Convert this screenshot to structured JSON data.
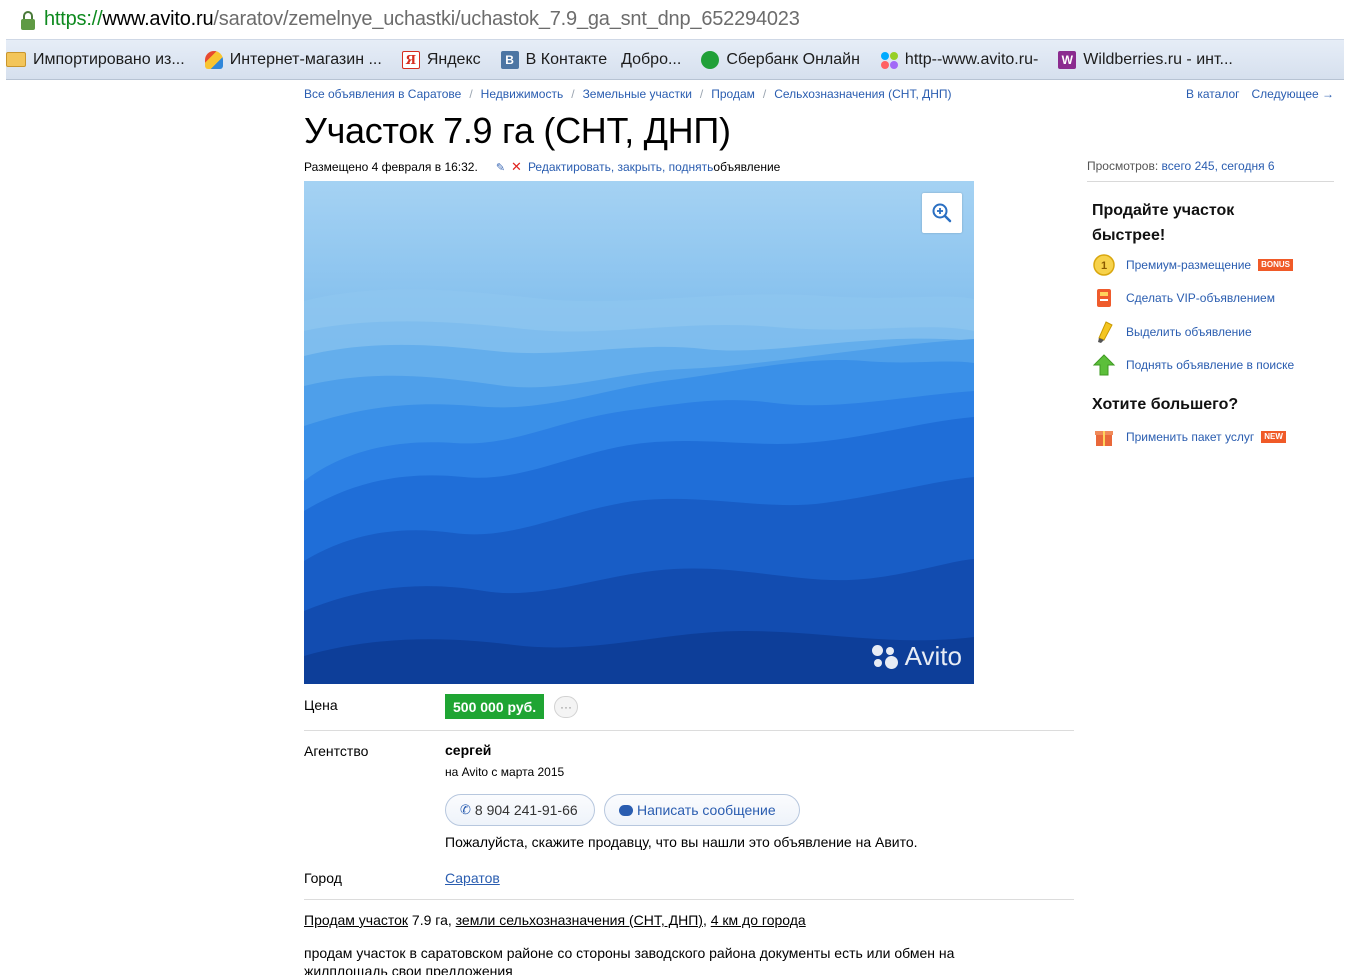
{
  "browser": {
    "url_scheme": "https://",
    "url_host": "www.avito.ru",
    "url_path": "/saratov/zemelnye_uchastki/uchastok_7.9_ga_snt_dnp_652294023"
  },
  "bookmarks": [
    {
      "label": "Импортировано из...",
      "icon": "folder-icon"
    },
    {
      "label": "Интернет-магазин ...",
      "icon": "shop-icon"
    },
    {
      "label": "Яндекс",
      "icon": "yandex-icon",
      "glyph": "Я"
    },
    {
      "label": "В Контакте",
      "icon": "vk-icon",
      "glyph": "В"
    },
    {
      "label": "Добро...",
      "icon": "none"
    },
    {
      "label": "Сбербанк Онлайн",
      "icon": "sberbank-icon"
    },
    {
      "label": "http--www.avito.ru-",
      "icon": "avito-icon"
    },
    {
      "label": "Wildberries.ru - инт...",
      "icon": "wildberries-icon",
      "glyph": "W"
    }
  ],
  "breadcrumbs": [
    "Все объявления в Саратове",
    "Недвижимость",
    "Земельные участки",
    "Продам",
    "Сельхозназначения (СНТ, ДНП)"
  ],
  "nav": {
    "catalog": "В каталог",
    "next": "Следующее →"
  },
  "listing": {
    "title": "Участок 7.9 га (СНТ, ДНП)",
    "posted": "Размещено 4 февраля в 16:32.",
    "edit_links": "Редактировать, закрыть, поднять",
    "edit_suffix": " объявление",
    "watermark": "Avito",
    "price_label": "Цена",
    "price": "500 000 руб.",
    "more_glyph": "···",
    "agency_label": "Агентство",
    "seller_name": "сергей",
    "seller_since": "на Avito с марта 2015",
    "phone": "8 904 241-91-66",
    "message_button": "Написать сообщение",
    "hint": "Пожалуйста, скажите продавцу, что вы нашли это объявление на Авито.",
    "city_label": "Город",
    "city": "Саратов",
    "summary_part1": "Продам участок",
    "summary_part2": " 7.9 га, ",
    "summary_part3": "земли сельхозназначения (СНТ, ДНП)",
    "summary_part4": ", ",
    "summary_part5": "4 км до города",
    "description": "продам участок в саратовском районе со стороны заводского района документы есть или обмен на жилплощадь свои предложения"
  },
  "views": {
    "label": "Просмотров: ",
    "total": "всего 245, сегодня 6"
  },
  "promo": {
    "title": "Продайте участок быстрее!",
    "items": [
      {
        "label": "Премиум-размещение",
        "badge": "BONUS",
        "icon": "premium-icon"
      },
      {
        "label": "Сделать VIP-объявлением",
        "badge": "",
        "icon": "vip-icon"
      },
      {
        "label": "Выделить объявление",
        "badge": "",
        "icon": "highlight-icon"
      },
      {
        "label": "Поднять объявление в поиске",
        "badge": "",
        "icon": "raise-icon"
      }
    ],
    "more_title": "Хотите большего?",
    "package": {
      "label": "Применить пакет услуг",
      "badge": "NEW",
      "icon": "package-icon"
    }
  },
  "colors": {
    "link": "#2a5db0",
    "price_bg": "#1fa533",
    "badge": "#f05a28",
    "url_scheme": "#0e8a1f"
  }
}
